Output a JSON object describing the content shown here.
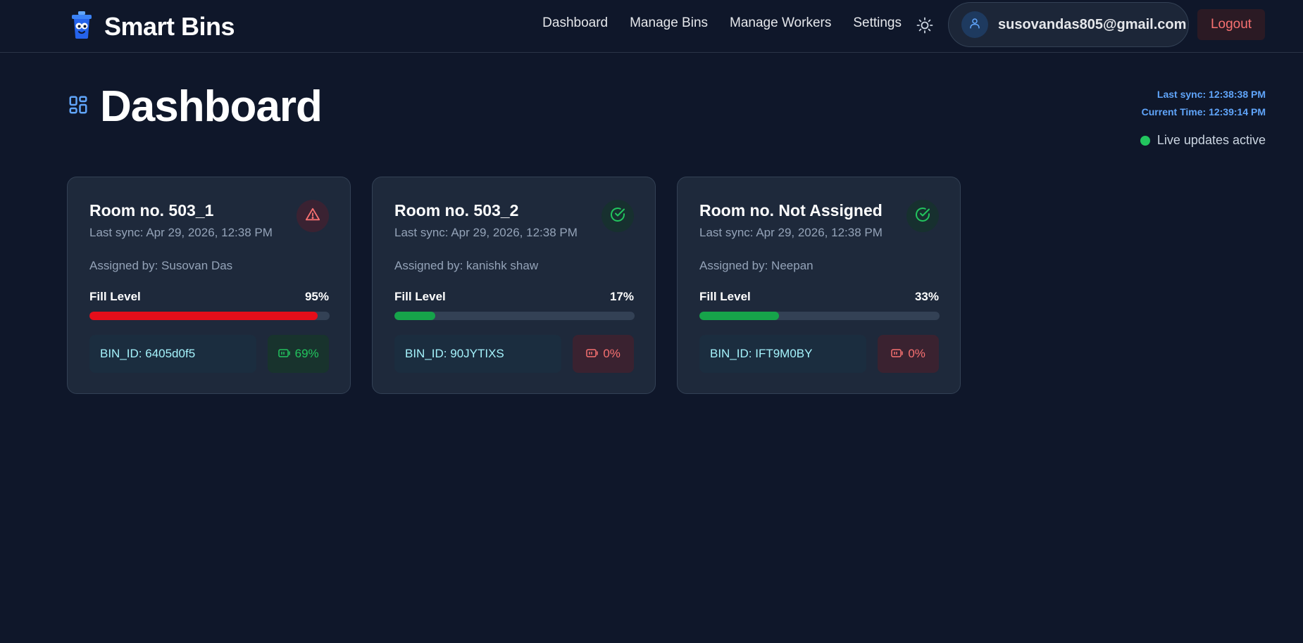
{
  "app": {
    "title": "Smart Bins"
  },
  "nav": {
    "links": [
      "Dashboard",
      "Manage Bins",
      "Manage Workers",
      "Settings"
    ],
    "user_email": "susovandas805@gmail.com",
    "logout_label": "Logout"
  },
  "page": {
    "title": "Dashboard",
    "last_sync": "Last sync: 12:38:38 PM",
    "current_time": "Current Time: 12:39:14 PM",
    "live_status": "Live updates active"
  },
  "colors": {
    "background": "#0f172a",
    "card": "#1e293b",
    "alert_red": "#e40e1a",
    "ok_green": "#16a34a",
    "accent_blue": "#60a5fa"
  },
  "bins": [
    {
      "room": "Room no. 503_1",
      "last_sync": "Last sync: Apr 29, 2026, 12:38 PM",
      "assigned_by": "Assigned by: Susovan Das",
      "fill_label": "Fill Level",
      "fill_text": "95%",
      "fill_percent": 95,
      "status": "alert",
      "status_icon": "warning-triangle-icon",
      "bin_id": "BIN_ID: 6405d0f5",
      "battery": "69%",
      "battery_state": "good"
    },
    {
      "room": "Room no. 503_2",
      "last_sync": "Last sync: Apr 29, 2026, 12:38 PM",
      "assigned_by": "Assigned by: kanishk shaw",
      "fill_label": "Fill Level",
      "fill_text": "17%",
      "fill_percent": 17,
      "status": "ok",
      "status_icon": "check-circle-icon",
      "bin_id": "BIN_ID: 90JYTIXS",
      "battery": "0%",
      "battery_state": "bad"
    },
    {
      "room": "Room no. Not Assigned",
      "last_sync": "Last sync: Apr 29, 2026, 12:38 PM",
      "assigned_by": "Assigned by: Neepan",
      "fill_label": "Fill Level",
      "fill_text": "33%",
      "fill_percent": 33,
      "status": "ok",
      "status_icon": "check-circle-icon",
      "bin_id": "BIN_ID: IFT9M0BY",
      "battery": "0%",
      "battery_state": "bad"
    }
  ]
}
